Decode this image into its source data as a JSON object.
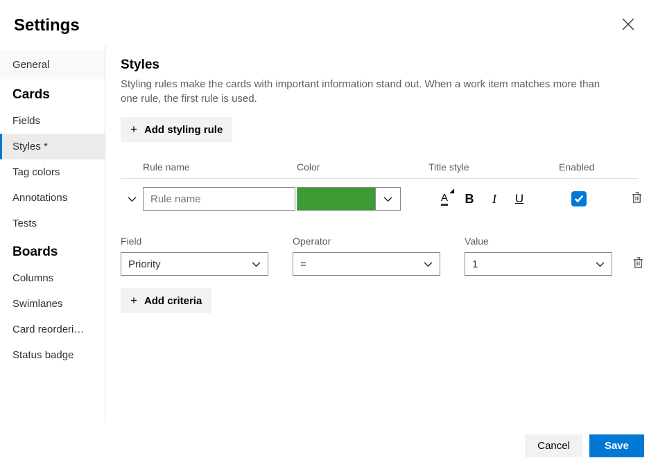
{
  "header": {
    "title": "Settings"
  },
  "sidebar": {
    "general": "General",
    "groups": [
      {
        "label": "Cards",
        "items": [
          {
            "label": "Fields",
            "active": false
          },
          {
            "label": "Styles *",
            "active": true
          },
          {
            "label": "Tag colors",
            "active": false
          },
          {
            "label": "Annotations",
            "active": false
          },
          {
            "label": "Tests",
            "active": false
          }
        ]
      },
      {
        "label": "Boards",
        "items": [
          {
            "label": "Columns",
            "active": false
          },
          {
            "label": "Swimlanes",
            "active": false
          },
          {
            "label": "Card reorderi…",
            "active": false
          },
          {
            "label": "Status badge",
            "active": false
          }
        ]
      }
    ]
  },
  "main": {
    "heading": "Styles",
    "subtitle": "Styling rules make the cards with important information stand out. When a work item matches more than one rule, the first rule is used.",
    "add_rule_label": "Add styling rule",
    "columns": {
      "name": "Rule name",
      "color": "Color",
      "title_style": "Title style",
      "enabled": "Enabled"
    },
    "rule": {
      "name_placeholder": "Rule name",
      "name_value": "",
      "color": "#3d9b35",
      "enabled": true
    },
    "criteria_columns": {
      "field": "Field",
      "operator": "Operator",
      "value": "Value"
    },
    "criteria": {
      "field": "Priority",
      "operator": "=",
      "value": "1"
    },
    "add_criteria_label": "Add criteria"
  },
  "footer": {
    "cancel": "Cancel",
    "save": "Save"
  }
}
